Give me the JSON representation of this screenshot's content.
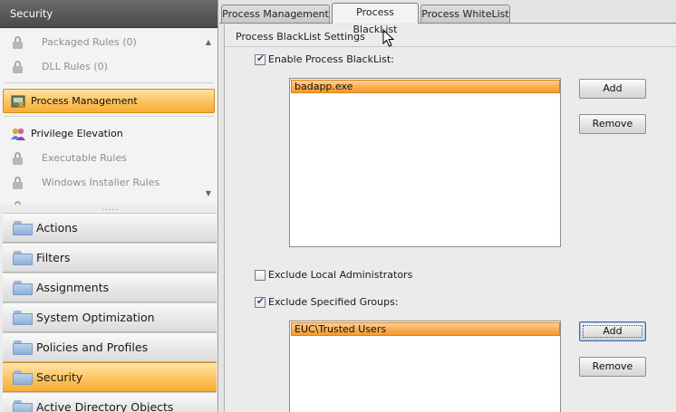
{
  "sidebar": {
    "header": "Security",
    "tree": {
      "packaged_rules": "Packaged Rules (0)",
      "dll_rules": "DLL Rules (0)",
      "process_management": "Process Management",
      "privilege_elevation": "Privilege Elevation",
      "executable_rules": "Executable Rules",
      "windows_installer_rules": "Windows Installer Rules",
      "scroll_up": "▲",
      "scroll_down": "▼",
      "grip": "....."
    },
    "nav": [
      {
        "label": "Actions",
        "active": false
      },
      {
        "label": "Filters",
        "active": false
      },
      {
        "label": "Assignments",
        "active": false
      },
      {
        "label": "System Optimization",
        "active": false
      },
      {
        "label": "Policies and Profiles",
        "active": false
      },
      {
        "label": "Security",
        "active": true
      },
      {
        "label": "Active Directory Objects",
        "active": false
      }
    ]
  },
  "tabs": [
    {
      "label": "Process Management",
      "active": false
    },
    {
      "label": "Process BlackList",
      "active": true
    },
    {
      "label": "Process WhiteList",
      "active": false
    }
  ],
  "settings": {
    "title": "Process BlackList Settings",
    "enable_blacklist": {
      "label": "Enable Process BlackList:",
      "checked": true
    },
    "blacklist_items": [
      "badapp.exe"
    ],
    "exclude_local_admins": {
      "label": "Exclude Local Administrators",
      "checked": false
    },
    "exclude_groups": {
      "label": "Exclude Specified Groups:",
      "checked": true
    },
    "group_items": [
      "EUC\\Trusted Users"
    ],
    "add_label": "Add",
    "remove_label": "Remove"
  },
  "colors": {
    "selection": "#fbac4f",
    "header_bg": "#555555",
    "folder_blue": "#8eafd6",
    "checkmark": "#2c4f7c"
  }
}
